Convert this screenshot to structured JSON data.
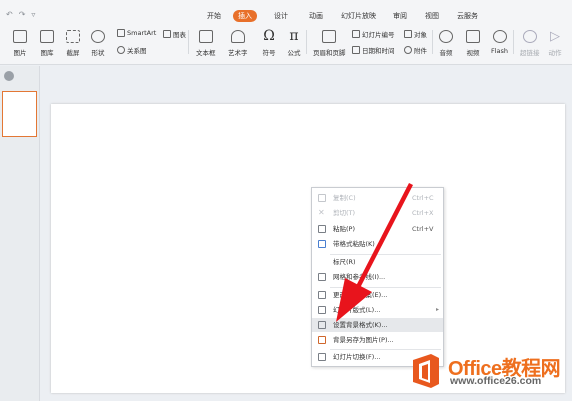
{
  "colors": {
    "accent": "#e8702a",
    "arrow": "#e8141c",
    "watermark": "#ee6f1e"
  },
  "quick_access": {
    "undo_icon": "undo-icon",
    "redo_icon": "redo-icon",
    "more_icon": "chevron-down-icon"
  },
  "tabs": [
    "开始",
    "插入",
    "设计",
    "动画",
    "幻灯片放映",
    "审阅",
    "视图",
    "云服务"
  ],
  "active_tab": "插入",
  "toolbar": {
    "picture": "图片",
    "gallery": "图库",
    "screenshot": "截屏",
    "shape": "形状",
    "smartart": "SmartArt",
    "chart": "图表",
    "relation": "关系图",
    "textbox": "文本框",
    "wordart": "艺术字",
    "symbol": "符号",
    "formula": "公式",
    "header_footer": "页眉和页脚",
    "slide_number": "幻灯片编号",
    "object": "对象",
    "datetime": "日期和时间",
    "attachment": "附件",
    "audio": "音频",
    "video": "视频",
    "flash": "Flash",
    "hyperlink": "超链接",
    "action": "动作"
  },
  "context_menu": {
    "copy": {
      "label": "复制(C)",
      "shortcut": "Ctrl+C"
    },
    "cut": {
      "label": "剪切(T)",
      "shortcut": "Ctrl+X"
    },
    "paste": {
      "label": "粘贴(P)",
      "shortcut": "Ctrl+V"
    },
    "paste_format": {
      "label": "带格式粘贴(K)"
    },
    "ruler": {
      "label": "标尺(R)"
    },
    "grid": {
      "label": "网格和参考线(I)..."
    },
    "color_scheme": {
      "label": "更改配色方案(E)..."
    },
    "layout": {
      "label": "幻灯片版式(L)..."
    },
    "background": {
      "label": "设置背景格式(K)..."
    },
    "save_background": {
      "label": "背景另存为图片(P)..."
    },
    "transition": {
      "label": "幻灯片切换(F)..."
    }
  },
  "watermark": {
    "brand": "Office教程网",
    "url": "www.office26.com"
  }
}
